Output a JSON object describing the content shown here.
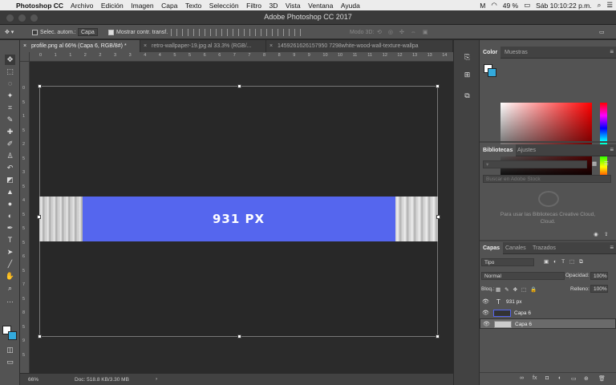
{
  "menubar": {
    "app": "Photoshop CC",
    "items": [
      "Archivo",
      "Edición",
      "Imagen",
      "Capa",
      "Texto",
      "Selección",
      "Filtro",
      "3D",
      "Vista",
      "Ventana",
      "Ayuda"
    ],
    "battery": "49 %",
    "clock": "Sáb 10:10:22 p.m."
  },
  "window": {
    "title": "Adobe Photoshop CC 2017"
  },
  "options": {
    "auto_select_label": "Selec. autom.:",
    "auto_select_value": "Capa",
    "show_transform_label": "Mostrar contr. transf.",
    "mode3d_label": "Modo 3D:"
  },
  "tabs": [
    {
      "label": "profile.png al 66% (Capa 6, RGB/8#) *",
      "active": true
    },
    {
      "label": "retro-wallpaper-19.jpg al 33.3% (RGB/...",
      "active": false
    },
    {
      "label": "1459261626157950 7298white-wood-wall-texture-wallpa",
      "active": false
    }
  ],
  "ruler": {
    "h": [
      "0",
      "1",
      "1",
      "2",
      "2",
      "3",
      "3",
      "4",
      "4",
      "5",
      "5",
      "6",
      "6",
      "7",
      "7",
      "8",
      "8",
      "9",
      "9",
      "10",
      "10",
      "11",
      "11",
      "12",
      "12",
      "13",
      "13",
      "14"
    ],
    "v": [
      "0",
      "5",
      "1",
      "5",
      "2",
      "5",
      "3",
      "5",
      "4",
      "5",
      "5",
      "5",
      "6",
      "5",
      "7",
      "5",
      "8",
      "5",
      "9",
      "5"
    ]
  },
  "canvas": {
    "banner_text": "931 PX"
  },
  "status": {
    "zoom": "66%",
    "doc": "Doc: 518.8 KB/3.30 MB"
  },
  "panels": {
    "color_tabs": [
      "Color",
      "Muestras"
    ],
    "library_tabs": [
      "Bibliotecas",
      "Ajustes"
    ],
    "library_search_placeholder": "Buscar en Adobe Stock",
    "library_message": "Para usar las Bibliotecas Creative Cloud,",
    "library_message2": "Cloud.",
    "layers_tabs": [
      "Capas",
      "Canales",
      "Trazados"
    ],
    "filter_kind": "Tipo",
    "blend_mode": "Normal",
    "opacity_label": "Opacidad:",
    "opacity_value": "100%",
    "lock_label": "Bloq.:",
    "fill_label": "Relleno:",
    "fill_value": "100%",
    "layers": [
      {
        "name": "931 px",
        "type": "text",
        "selected": false
      },
      {
        "name": "Capa 6",
        "type": "pixel",
        "selected": false
      },
      {
        "name": "Capa 6",
        "type": "pixel",
        "selected": true
      }
    ]
  },
  "colors": {
    "accent": "#5566ee",
    "foreground": "#ffffff",
    "background": "#33aadd"
  }
}
